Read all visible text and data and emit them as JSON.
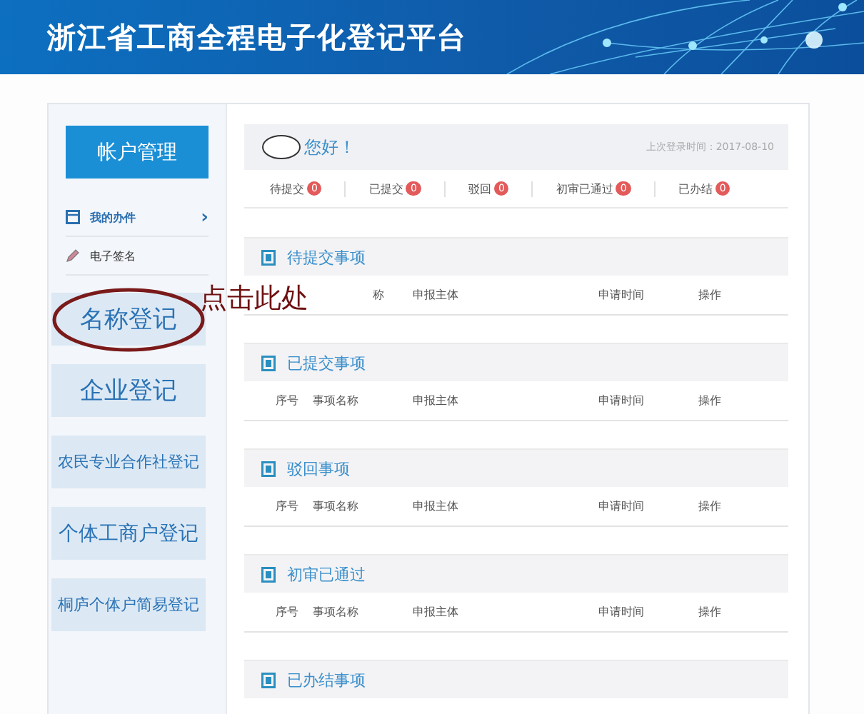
{
  "header": {
    "title": "浙江省工商全程电子化登记平台"
  },
  "sidebar": {
    "account_button": "帐户管理",
    "links": [
      {
        "label": "我的办件",
        "kind": "folder",
        "chevron": "›"
      },
      {
        "label": "电子签名",
        "kind": "pen"
      }
    ],
    "tiles": [
      {
        "label": "名称登记",
        "circled": true
      },
      {
        "label": "企业登记",
        "circled": false
      },
      {
        "label": "农民专业合作社登记",
        "circled": false
      },
      {
        "label": "个体工商户登记",
        "circled": false
      },
      {
        "label": "桐庐个体户简易登记",
        "circled": false
      }
    ]
  },
  "annotation": {
    "text": "点击此处"
  },
  "greeting": {
    "text": "您好！",
    "last_login": "上次登录时间：2017-08-10"
  },
  "stats": [
    {
      "label": "待提交",
      "count": "0"
    },
    {
      "label": "已提交",
      "count": "0"
    },
    {
      "label": "驳回",
      "count": "0"
    },
    {
      "label": "初审已通过",
      "count": "0"
    },
    {
      "label": "已办结",
      "count": "0"
    }
  ],
  "sections": [
    {
      "title": "待提交事项",
      "columns": [
        "称",
        "申报主体",
        "申请时间",
        "操作"
      ]
    },
    {
      "title": "已提交事项",
      "columns": [
        "序号",
        "事项名称",
        "申报主体",
        "申请时间",
        "操作"
      ]
    },
    {
      "title": "驳回事项",
      "columns": [
        "序号",
        "事项名称",
        "申报主体",
        "申请时间",
        "操作"
      ]
    },
    {
      "title": "初审已通过",
      "columns": [
        "序号",
        "事项名称",
        "申报主体",
        "申请时间",
        "操作"
      ]
    },
    {
      "title": "已办结事项"
    }
  ]
}
